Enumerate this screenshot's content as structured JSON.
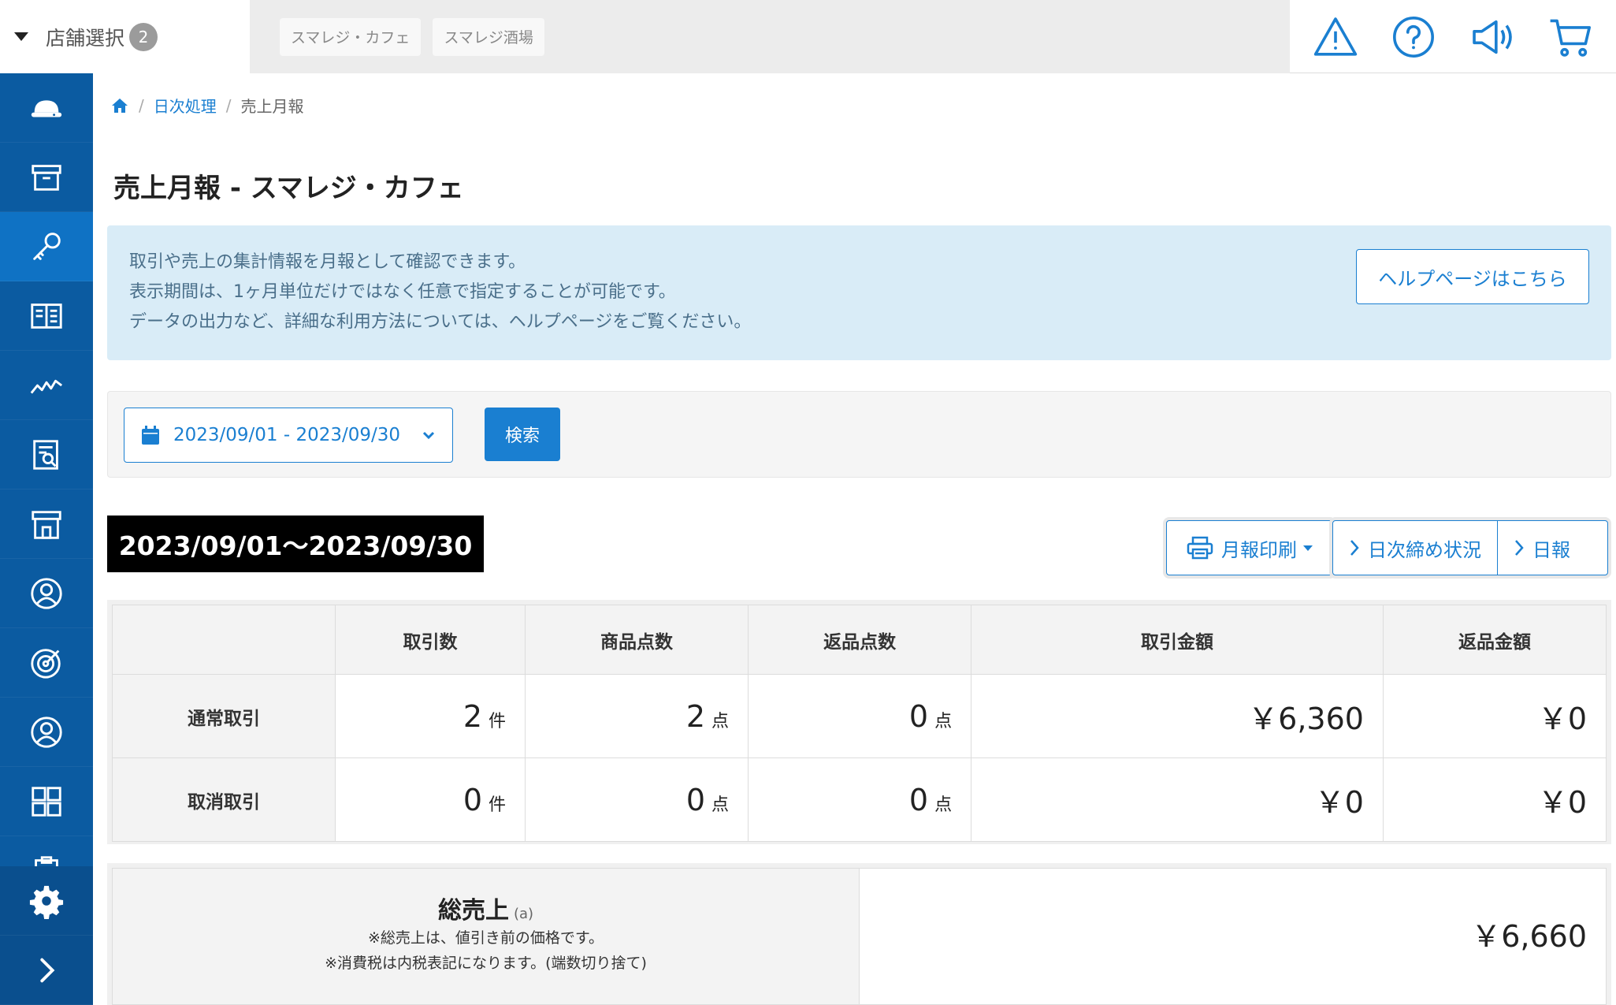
{
  "header": {
    "store_select_label": "店舗選択",
    "store_count": "2",
    "store_tabs": [
      "スマレジ・カフェ",
      "スマレジ酒場"
    ],
    "icons": [
      "warning-icon",
      "help-icon",
      "megaphone-icon",
      "cart-icon"
    ]
  },
  "sidebar": {
    "items": [
      "cloud-register-icon",
      "archive-icon",
      "key-icon",
      "book-icon",
      "chart-icon",
      "report-icon",
      "store-icon",
      "customer-icon",
      "target-icon",
      "member-icon",
      "grid-icon",
      "clipboard-icon"
    ],
    "active_index": 2,
    "bottom": [
      "settings-icon",
      "expand-icon"
    ]
  },
  "breadcrumb": {
    "home_icon": "home-icon",
    "daily": "日次処理",
    "current": "売上月報"
  },
  "page": {
    "title": "売上月報 - スマレジ・カフェ"
  },
  "info": {
    "lines": [
      "取引や売上の集計情報を月報として確認できます。",
      "表示期間は、1ヶ月単位だけではなく任意で指定することが可能です。",
      "データの出力など、詳細な利用方法については、ヘルプページをご覧ください。"
    ],
    "help_button": "ヘルプページはこちら"
  },
  "filter": {
    "date_range": "2023/09/01 - 2023/09/30",
    "search_button": "検索"
  },
  "period": {
    "label": "2023/09/01〜2023/09/30"
  },
  "actions": {
    "print": "月報印刷",
    "daily_close": "日次締め状況",
    "daily_report": "日報"
  },
  "summary_table": {
    "columns": [
      "取引数",
      "商品点数",
      "返品点数",
      "取引金額",
      "返品金額"
    ],
    "rows": [
      {
        "label": "通常取引",
        "count": "2",
        "count_unit": "件",
        "items": "2",
        "items_unit": "点",
        "returns": "0",
        "returns_unit": "点",
        "amount": "￥6,360",
        "return_amount": "￥0"
      },
      {
        "label": "取消取引",
        "count": "0",
        "count_unit": "件",
        "items": "0",
        "items_unit": "点",
        "returns": "0",
        "returns_unit": "点",
        "amount": "￥0",
        "return_amount": "￥0"
      }
    ]
  },
  "gross_sales": {
    "label": "総売上",
    "tag": "(a)",
    "note1": "※総売上は、値引き前の価格です。",
    "note2": "※消費税は内税表記になります。(端数切り捨て)",
    "value": "￥6,660"
  },
  "colors": {
    "sidebar": "#0b5ba1",
    "sidebar_active": "#0f72c4",
    "accent": "#1a7fd1",
    "info_bg": "#d9ecf7"
  }
}
